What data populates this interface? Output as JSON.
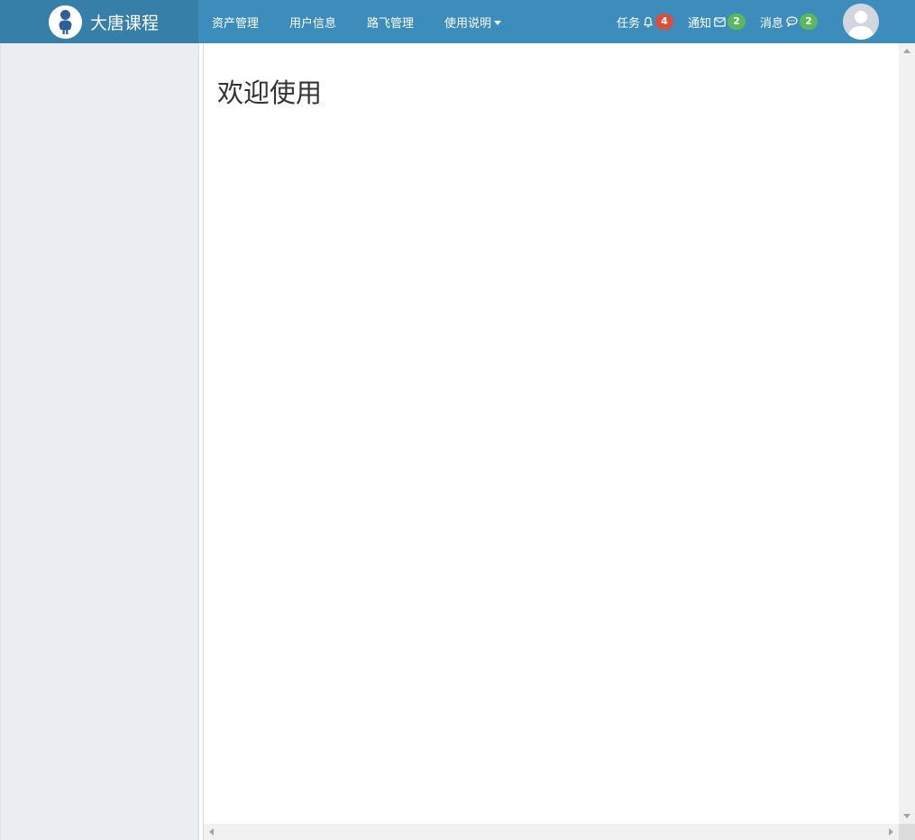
{
  "brand": {
    "title": "大唐课程",
    "logo_icon": "person-icon"
  },
  "nav": {
    "items": [
      {
        "label": "资产管理"
      },
      {
        "label": "用户信息"
      },
      {
        "label": "路飞管理"
      },
      {
        "label": "使用说明",
        "has_dropdown": true
      }
    ]
  },
  "notifications": {
    "tasks": {
      "label": "任务",
      "icon": "bell-icon",
      "count": "4"
    },
    "notices": {
      "label": "通知",
      "icon": "envelope-icon",
      "count": "2"
    },
    "messages": {
      "label": "消息",
      "icon": "comment-icon",
      "count": "2"
    }
  },
  "user": {
    "avatar_icon": "user-avatar-icon"
  },
  "main": {
    "title": "欢迎使用"
  },
  "colors": {
    "header": "#3c8dbc",
    "brand_bg": "#367fa9",
    "sidebar": "#eaedf1",
    "badge_red": "#dd4b39",
    "badge_green": "#5cb85c"
  }
}
